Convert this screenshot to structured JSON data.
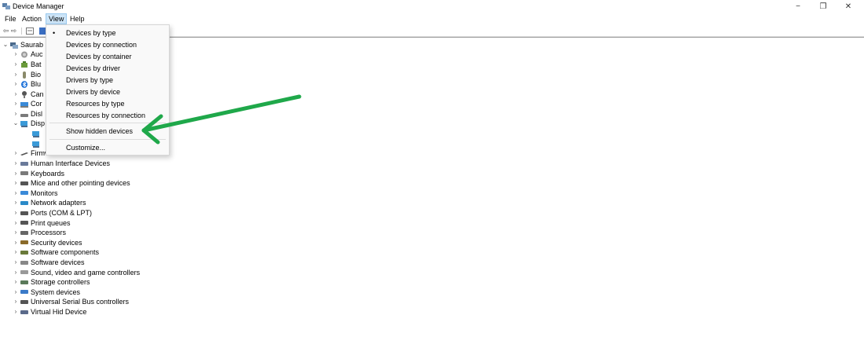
{
  "window": {
    "title": "Device Manager",
    "minimize": "−",
    "restore": "❐",
    "close": "✕"
  },
  "menu": {
    "file": "File",
    "action": "Action",
    "view": "View",
    "help": "Help"
  },
  "toolbar": {
    "back": "⇦",
    "forward": "⇨"
  },
  "tree": {
    "root": "Saurab",
    "partial_items": [
      "Auc",
      "Bat",
      "Bio",
      "Blu",
      "Can",
      "Cor",
      "Disl",
      "Disp"
    ],
    "firmware": "Firmware",
    "items": [
      "Human Interface Devices",
      "Keyboards",
      "Mice and other pointing devices",
      "Monitors",
      "Network adapters",
      "Ports (COM & LPT)",
      "Print queues",
      "Processors",
      "Security devices",
      "Software components",
      "Software devices",
      "Sound, video and game controllers",
      "Storage controllers",
      "System devices",
      "Universal Serial Bus controllers",
      "Virtual Hid Device"
    ]
  },
  "view_menu": {
    "bullet": "•",
    "devices_by_type": "Devices by type",
    "devices_by_connection": "Devices by connection",
    "devices_by_container": "Devices by container",
    "devices_by_driver": "Devices by driver",
    "drivers_by_type": "Drivers by type",
    "drivers_by_device": "Drivers by device",
    "resources_by_type": "Resources by type",
    "resources_by_connection": "Resources by connection",
    "show_hidden_devices": "Show hidden devices",
    "customize": "Customize..."
  },
  "colors": {
    "arrow": "#1fa84a",
    "menu_highlight": "#cce4f7"
  }
}
